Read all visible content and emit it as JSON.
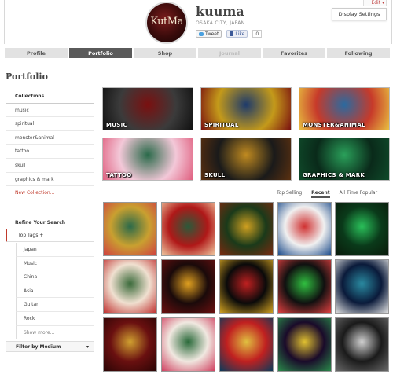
{
  "header": {
    "avatar_text": "KutMa",
    "username": "kuuma",
    "location": "OSAKA CITY, JAPAN",
    "tweet_label": "Tweet",
    "like_label": "Like",
    "like_count": "0",
    "edit_label": "Edit ▾",
    "display_settings_label": "Display Settings"
  },
  "tabs": [
    {
      "label": "Profile"
    },
    {
      "label": "Portfolio"
    },
    {
      "label": "Shop"
    },
    {
      "label": "Journal"
    },
    {
      "label": "Favorites"
    },
    {
      "label": "Following"
    }
  ],
  "page_title": "Portfolio",
  "sidebar": {
    "collections_heading": "Collections",
    "collections": [
      "music",
      "spiritual",
      "monster&animal",
      "tattoo",
      "skull",
      "graphics & mark"
    ],
    "new_collection": "New Collection...",
    "refine_heading": "Refine Your Search",
    "top_tags_label": "Top Tags +",
    "tags": [
      "Japan",
      "Music",
      "China",
      "Asia",
      "Guitar",
      "Rock"
    ],
    "show_more": "Show more...",
    "filter_label": "Filter by Medium",
    "filter_caret": "▾"
  },
  "collection_tiles": [
    {
      "label": "MUSIC",
      "colors": [
        "#3b3b3b",
        "#7a1010",
        "#111111"
      ]
    },
    {
      "label": "SPIRITUAL",
      "colors": [
        "#c49a1a",
        "#1d3a6b",
        "#7a1010"
      ]
    },
    {
      "label": "MONSTER&ANIMAL",
      "colors": [
        "#c73a2a",
        "#2a6aa0",
        "#e8c040"
      ]
    },
    {
      "label": "TATTOO",
      "colors": [
        "#f3c8d8",
        "#2a6a4a",
        "#e06080"
      ]
    },
    {
      "label": "SKULL",
      "colors": [
        "#1a1a1a",
        "#c08a20",
        "#5a3010"
      ]
    },
    {
      "label": "GRAPHICS & MARK",
      "colors": [
        "#0a2a1a",
        "#2aa05a",
        "#0f4a2a"
      ]
    }
  ],
  "sort_tabs": [
    {
      "label": "Top Selling"
    },
    {
      "label": "Recent"
    },
    {
      "label": "All Time Popular"
    }
  ],
  "grid": [
    {
      "colors": [
        "#c9a030",
        "#2a6a4a",
        "#d04040"
      ]
    },
    {
      "colors": [
        "#b01818",
        "#2a5a3a",
        "#f0c8a0"
      ]
    },
    {
      "colors": [
        "#1a3a1a",
        "#d0a020",
        "#7a2a10"
      ]
    },
    {
      "colors": [
        "#f0f0f0",
        "#d03030",
        "#1a4a8a"
      ]
    },
    {
      "colors": [
        "#0a3a1a",
        "#2ac05a",
        "#0a1a0a"
      ]
    },
    {
      "colors": [
        "#f0e0d0",
        "#3a6a3a",
        "#c03030"
      ]
    },
    {
      "colors": [
        "#1a0a0a",
        "#e0a020",
        "#6a1010"
      ]
    },
    {
      "colors": [
        "#0a0a0a",
        "#c02020",
        "#d0a020"
      ]
    },
    {
      "colors": [
        "#101010",
        "#30c040",
        "#e04040"
      ]
    },
    {
      "colors": [
        "#0a1a3a",
        "#2a8aa0",
        "#e0e0e0"
      ]
    },
    {
      "colors": [
        "#6a1010",
        "#d0a030",
        "#2a0505"
      ]
    },
    {
      "colors": [
        "#f0e8e0",
        "#2a6a3a",
        "#d04060"
      ]
    },
    {
      "colors": [
        "#c02020",
        "#e0c040",
        "#0a3a5a"
      ]
    },
    {
      "colors": [
        "#1a0a2a",
        "#e0c030",
        "#2a8a4a"
      ]
    },
    {
      "colors": [
        "#1a1a1a",
        "#d0d0d0",
        "#6a6a6a"
      ]
    }
  ]
}
